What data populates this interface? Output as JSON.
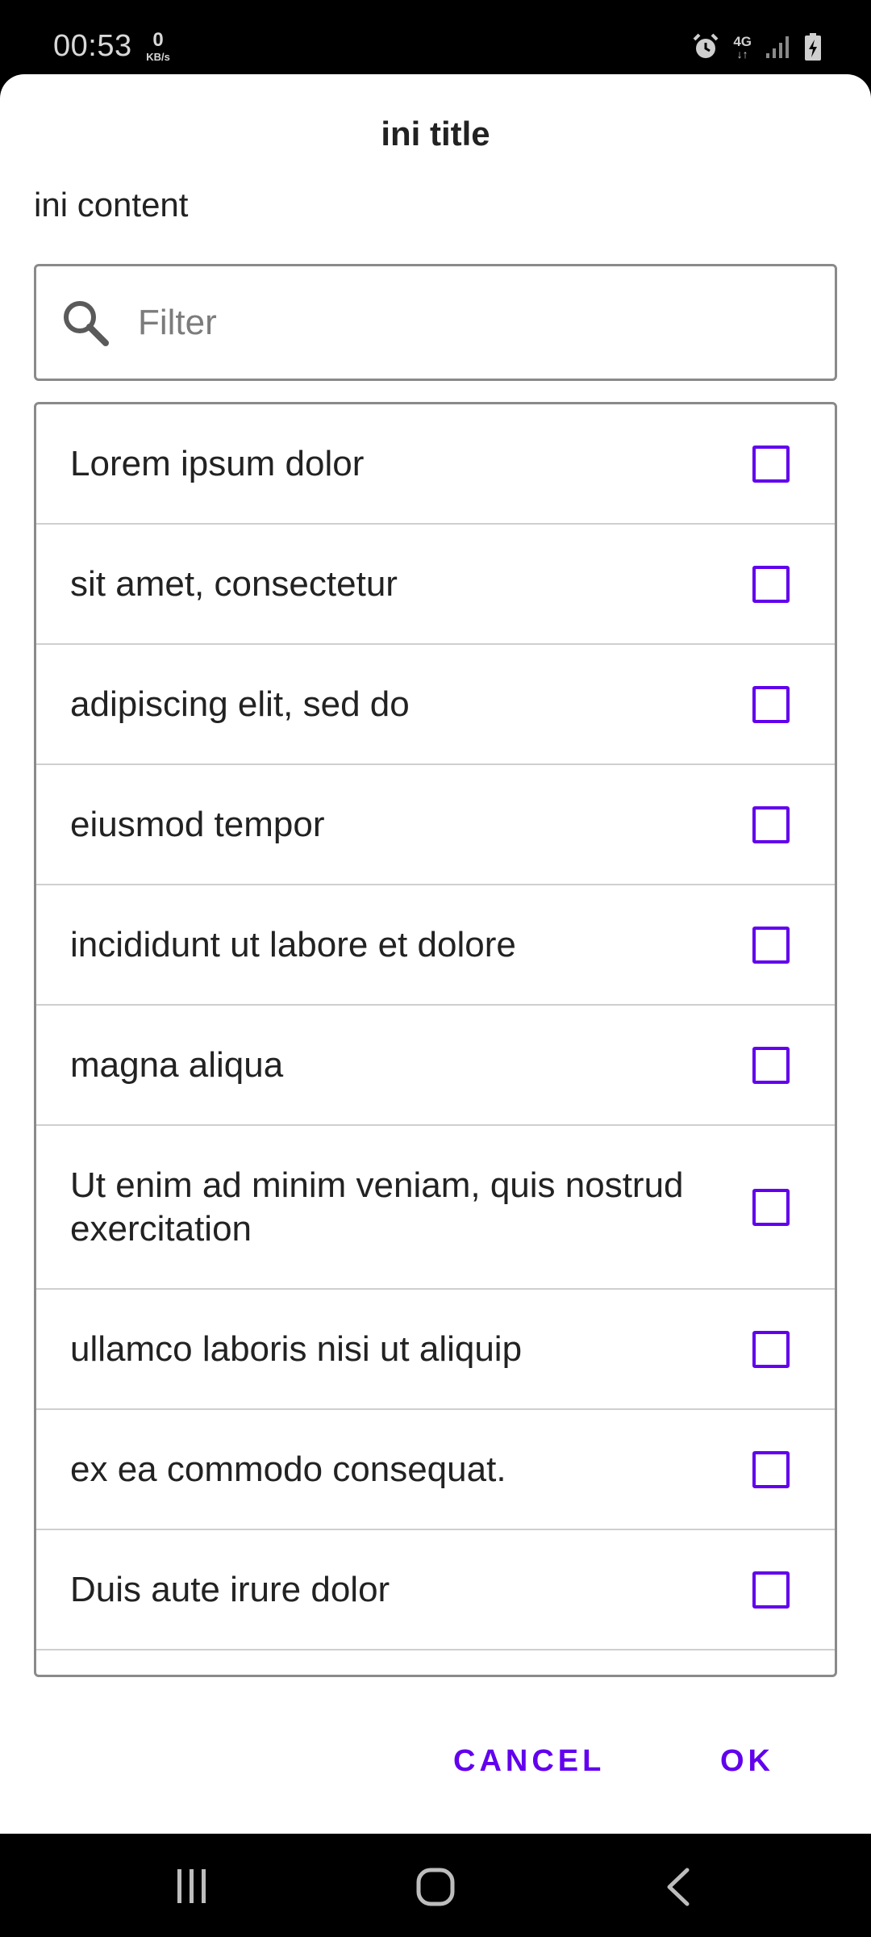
{
  "status_bar": {
    "time": "00:53",
    "net_speed_value": "0",
    "net_speed_unit": "KB/s",
    "network_type": "4G",
    "icons": [
      "alarm-icon",
      "network-4g-icon",
      "signal-icon",
      "battery-charging-icon"
    ]
  },
  "dialog": {
    "title": "ini title",
    "content": "ini content",
    "filter": {
      "placeholder": "Filter",
      "value": ""
    },
    "items": [
      {
        "label": "Lorem ipsum dolor",
        "checked": false
      },
      {
        "label": "sit amet, consectetur",
        "checked": false
      },
      {
        "label": "adipiscing elit, sed do",
        "checked": false
      },
      {
        "label": "eiusmod tempor",
        "checked": false
      },
      {
        "label": "incididunt ut labore et dolore",
        "checked": false
      },
      {
        "label": "magna aliqua",
        "checked": false
      },
      {
        "label": "Ut enim ad minim veniam, quis nostrud exercitation",
        "checked": false
      },
      {
        "label": "ullamco laboris nisi ut aliquip",
        "checked": false
      },
      {
        "label": "ex ea commodo consequat.",
        "checked": false
      },
      {
        "label": "Duis aute irure dolor",
        "checked": false
      }
    ],
    "actions": {
      "cancel_label": "CANCEL",
      "ok_label": "OK"
    }
  },
  "nav_bar": {
    "icons": [
      "recent-apps-icon",
      "home-icon",
      "back-icon"
    ]
  },
  "colors": {
    "accent": "#6200ee",
    "dialog_background": "#ffffff",
    "system_bars": "#000000"
  }
}
